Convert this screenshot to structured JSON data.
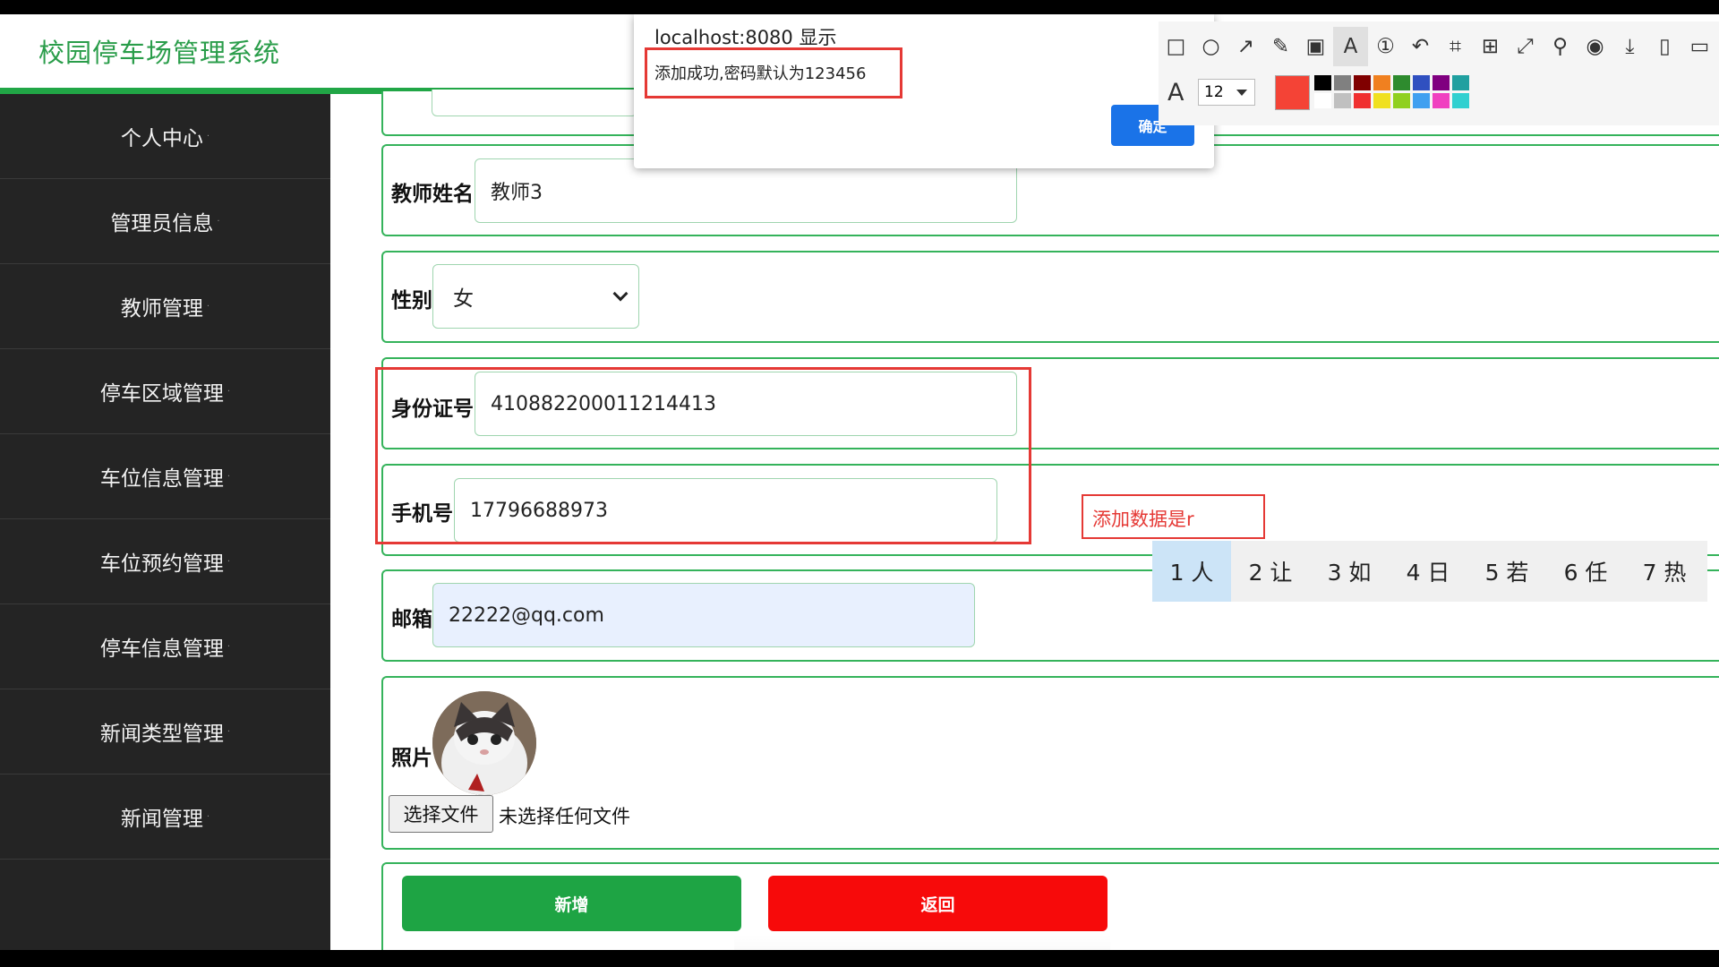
{
  "header": {
    "title": "校园停车场管理系统"
  },
  "sidebar": {
    "items": [
      {
        "label": "个人中心"
      },
      {
        "label": "管理员信息"
      },
      {
        "label": "教师管理"
      },
      {
        "label": "停车区域管理"
      },
      {
        "label": "车位信息管理"
      },
      {
        "label": "车位预约管理"
      },
      {
        "label": "停车信息管理"
      },
      {
        "label": "新闻类型管理"
      },
      {
        "label": "新闻管理"
      }
    ]
  },
  "form": {
    "teacher_name": {
      "label": "教师姓名",
      "value": "教师3"
    },
    "gender": {
      "label": "性别",
      "value": "女"
    },
    "id_number": {
      "label": "身份证号",
      "value": "410882200011214413"
    },
    "phone": {
      "label": "手机号",
      "value": "17796688973"
    },
    "email": {
      "label": "邮箱",
      "value": "22222@qq.com"
    },
    "photo": {
      "label": "照片",
      "choose_file": "选择文件",
      "no_file": "未选择任何文件"
    },
    "buttons": {
      "add": "新增",
      "back": "返回"
    }
  },
  "dialog": {
    "title": "localhost:8080 显示",
    "message": "添加成功,密码默认为123456",
    "ok": "确定"
  },
  "toolbar": {
    "font_size": "12",
    "current_color": "#f44336",
    "swatches": [
      "#000000",
      "#808080",
      "#800000",
      "#f08020",
      "#2e8b2e",
      "#3050c0",
      "#800080",
      "#20a0a0",
      "#ffffff",
      "#c0c0c0",
      "#f03030",
      "#f0e020",
      "#90d020",
      "#40a0f0",
      "#f040c0",
      "#30d0d0"
    ]
  },
  "annotation": {
    "text": "添加数据是r"
  },
  "ime": {
    "candidates": [
      "1 人",
      "2 让",
      "3 如",
      "4 日",
      "5 若",
      "6 任",
      "7 热"
    ]
  },
  "colors": {
    "brand_green": "#21a646",
    "sidebar_bg": "#242424",
    "danger": "#f70a0a",
    "primary": "#1a73e8"
  }
}
